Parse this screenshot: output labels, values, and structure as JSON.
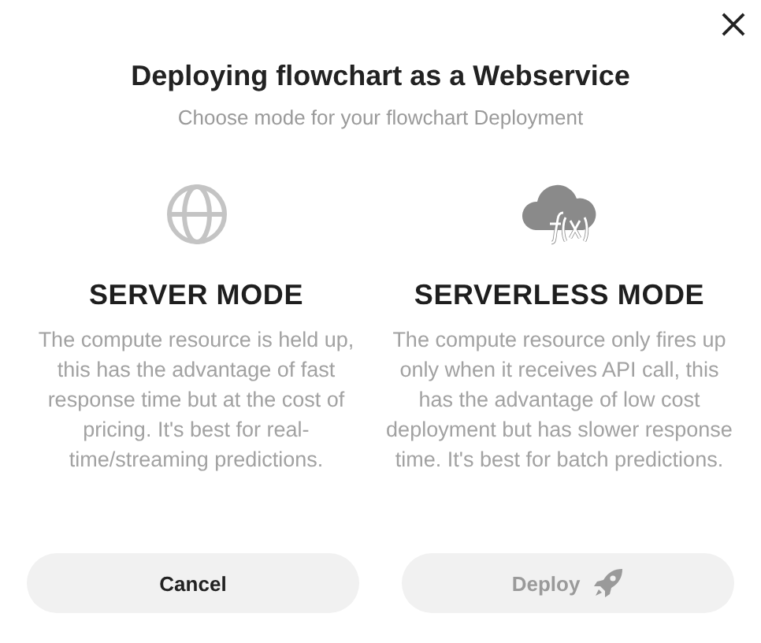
{
  "dialog": {
    "title": "Deploying flowchart as a Webservice",
    "subtitle": "Choose mode for your flowchart Deployment"
  },
  "modes": [
    {
      "kind": "server",
      "title": "SERVER MODE",
      "description": "The compute resource is held up, this has the advantage of fast response time but at the cost of pricing. It's best for real-time/streaming predictions."
    },
    {
      "kind": "serverless",
      "title": "SERVERLESS MODE",
      "description": "The compute resource only fires up only when it receives API call, this has the advantage of low cost deployment but has slower response time. It's best for batch predictions."
    }
  ],
  "buttons": [
    {
      "kind": "cancel",
      "label": "Cancel",
      "disabled": false
    },
    {
      "kind": "deploy",
      "label": "Deploy",
      "disabled": true
    }
  ]
}
